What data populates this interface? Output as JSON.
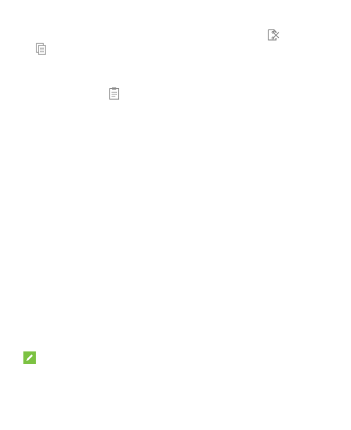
{
  "icons": {
    "cut": "cut-icon",
    "copy": "copy-icon",
    "paste": "paste-icon",
    "note": "note-pencil-icon"
  },
  "colors": {
    "icon_gray": "#8a8a8a",
    "note_green": "#7cc242",
    "background": "#ffffff"
  }
}
